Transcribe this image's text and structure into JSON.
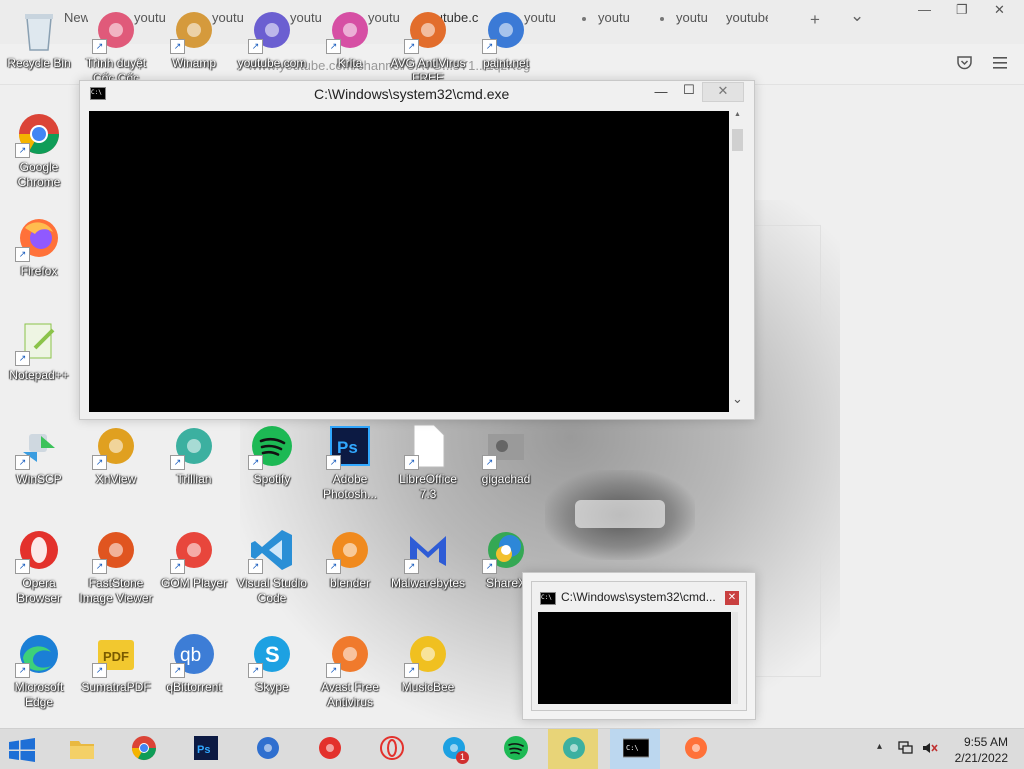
{
  "browser": {
    "tabs": [
      {
        "label": "New",
        "dot": false
      },
      {
        "label": "youtu",
        "dot": true
      },
      {
        "label": "youtu",
        "dot": true
      },
      {
        "label": "youtu",
        "dot": true
      },
      {
        "label": "youtu",
        "dot": true
      },
      {
        "label": "youtube.c",
        "dot": false
      },
      {
        "label": "youtu",
        "dot": true
      },
      {
        "label": "youtu",
        "dot": true
      },
      {
        "label": "youtu",
        "dot": true
      },
      {
        "label": "youtube",
        "dot": false
      }
    ],
    "new_tab": "+",
    "tab_list": "⌄",
    "minimize": "—",
    "restore": "❐",
    "close": "✕",
    "url": "www.youtube.com/channel/UAVG...sY1...1qzK9g",
    "pocket_icon": "pocket-icon",
    "menu_icon": "hamburger-menu-icon"
  },
  "desktop": {
    "icons": [
      {
        "label": "Recycle Bin",
        "icon": "recycle-bin-icon",
        "color": "#9fb6c8"
      },
      {
        "label": "Trình duyệt Cốc Cốc",
        "icon": "coccoc-icon",
        "color": "#e05a7a"
      },
      {
        "label": "Winamp",
        "icon": "winamp-icon",
        "color": "#d59a3c"
      },
      {
        "label": "youtube.com",
        "icon": "audio-icon",
        "color": "#6b5fd1"
      },
      {
        "label": "Krita",
        "icon": "krita-icon",
        "color": "#d64fa4"
      },
      {
        "label": "AVG AntiVirus FREE",
        "icon": "avg-icon",
        "color": "#e26d2c"
      },
      {
        "label": "paint.net",
        "icon": "paintnet-icon",
        "color": "#3b7ad6"
      },
      {
        "label": "Google Chrome",
        "icon": "chrome-icon",
        "color": "#4285f4"
      },
      {
        "label": "Firefox",
        "icon": "firefox-icon",
        "color": "#ff7139"
      },
      {
        "label": "Notepad++",
        "icon": "notepadpp-icon",
        "color": "#8bc34a"
      },
      {
        "label": "WinSCP",
        "icon": "winscp-icon",
        "color": "#3a9de0"
      },
      {
        "label": "XnView",
        "icon": "xnview-icon",
        "color": "#e0a020"
      },
      {
        "label": "Trillian",
        "icon": "trillian-icon",
        "color": "#3cb0a0"
      },
      {
        "label": "Spotify",
        "icon": "spotify-icon",
        "color": "#1db954"
      },
      {
        "label": "Adobe Photosh...",
        "icon": "photoshop-icon",
        "color": "#2b3f8c"
      },
      {
        "label": "LibreOffice 7.3",
        "icon": "libreoffice-icon",
        "color": "#ffffff"
      },
      {
        "label": "gigachad",
        "icon": "image-file-icon",
        "color": "#888888"
      },
      {
        "label": "Opera Browser",
        "icon": "opera-icon",
        "color": "#e3312c"
      },
      {
        "label": "FastStone Image Viewer",
        "icon": "faststone-icon",
        "color": "#e05520"
      },
      {
        "label": "GOM Player",
        "icon": "gom-player-icon",
        "color": "#e8463c"
      },
      {
        "label": "Visual Studio Code",
        "icon": "vscode-icon",
        "color": "#2a8fd6"
      },
      {
        "label": "blender",
        "icon": "blender-icon",
        "color": "#f08a1e"
      },
      {
        "label": "Malwarebytes",
        "icon": "malwarebytes-icon",
        "color": "#2e5cd6"
      },
      {
        "label": "ShareX",
        "icon": "sharex-icon",
        "color": "#35a854"
      },
      {
        "label": "Microsoft Edge",
        "icon": "edge-icon",
        "color": "#1fa56b"
      },
      {
        "label": "SumatraPDF",
        "icon": "sumatrapdf-icon",
        "color": "#f2c82f"
      },
      {
        "label": "qBittorrent",
        "icon": "qbittorrent-icon",
        "color": "#3d7dd6"
      },
      {
        "label": "Skype",
        "icon": "skype-icon",
        "color": "#1da1e2"
      },
      {
        "label": "Avast Free Antivirus",
        "icon": "avast-icon",
        "color": "#f07a2c"
      },
      {
        "label": "MusicBee",
        "icon": "musicbee-icon",
        "color": "#f0c020"
      }
    ]
  },
  "cmd_main": {
    "title": "C:\\Windows\\system32\\cmd.exe",
    "icon": "cmd-icon",
    "minimize": "—",
    "maximize": "☐",
    "close": "✕",
    "scroll_up": "▲",
    "scroll_down": "⌄"
  },
  "cmd_small": {
    "title": "C:\\Windows\\system32\\cmd...",
    "icon": "cmd-icon",
    "close": "✕"
  },
  "taskbar": {
    "start_icon": "windows-start-icon",
    "items": [
      {
        "name": "file-explorer",
        "icon": "folder-icon",
        "color": "#e9b940",
        "state": "normal"
      },
      {
        "name": "chrome",
        "icon": "chrome-icon",
        "color": "#4285f4",
        "state": "normal"
      },
      {
        "name": "photoshop",
        "icon": "photoshop-icon",
        "color": "#1e2d6b",
        "state": "normal"
      },
      {
        "name": "thunderbird",
        "icon": "thunderbird-icon",
        "color": "#2f6fcf",
        "state": "normal"
      },
      {
        "name": "opera",
        "icon": "opera-icon",
        "color": "#e3312c",
        "state": "normal"
      },
      {
        "name": "opera-gx",
        "icon": "opera-gx-icon",
        "color": "#e3312c",
        "state": "normal"
      },
      {
        "name": "skype",
        "icon": "skype-icon",
        "color": "#1da1e2",
        "state": "normal",
        "badge": "1"
      },
      {
        "name": "spotify",
        "icon": "spotify-icon",
        "color": "#1db954",
        "state": "normal"
      },
      {
        "name": "trillian",
        "icon": "trillian-icon",
        "color": "#3cb0a0",
        "state": "highlight"
      },
      {
        "name": "cmd",
        "icon": "cmd-icon",
        "color": "#000000",
        "state": "active"
      },
      {
        "name": "firefox",
        "icon": "firefox-icon",
        "color": "#ff7139",
        "state": "normal"
      }
    ],
    "tray": {
      "chevron": "▴",
      "network_icon": "network-icon",
      "volume_icon": "volume-muted-icon",
      "time": "9:55 AM",
      "date": "2/21/2022"
    }
  }
}
